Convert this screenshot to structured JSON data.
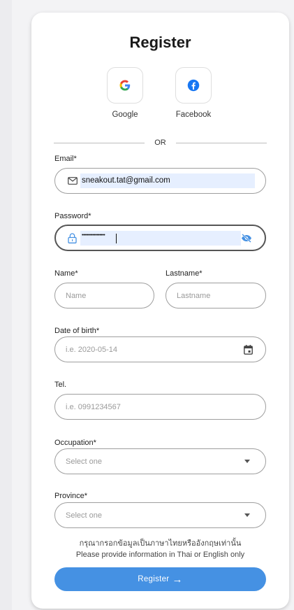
{
  "form": {
    "title": "Register",
    "social": [
      {
        "label": "Google",
        "icon": "google-icon"
      },
      {
        "label": "Facebook",
        "icon": "facebook-icon"
      }
    ],
    "or_text": "OR",
    "email": {
      "label": "Email*",
      "value": "sneakout.tat@gmail.com"
    },
    "password": {
      "label": "Password*",
      "value": "•••••••••••••••••"
    },
    "name": {
      "label": "Name*",
      "placeholder": "Name"
    },
    "lastname": {
      "label": "Lastname*",
      "placeholder": "Lastname"
    },
    "dob": {
      "label": "Date of birth*",
      "placeholder": "i.e. 2020-05-14"
    },
    "tel": {
      "label": "Tel.",
      "placeholder": "i.e. 0991234567"
    },
    "occupation": {
      "label": "Occupation*",
      "placeholder": "Select one"
    },
    "province": {
      "label": "Province*",
      "placeholder": "Select one"
    },
    "notice_th": "กรุณากรอกข้อมูลเป็นภาษาไทยหรืออังกฤษเท่านั้น",
    "notice_en": "Please provide information in Thai or English only",
    "submit_label": "Register",
    "submit_arrow": "→"
  },
  "colors": {
    "accent": "#4591e3",
    "google_blue": "#4285F4",
    "facebook_blue": "#1877F2",
    "highlight": "#e6efff"
  }
}
